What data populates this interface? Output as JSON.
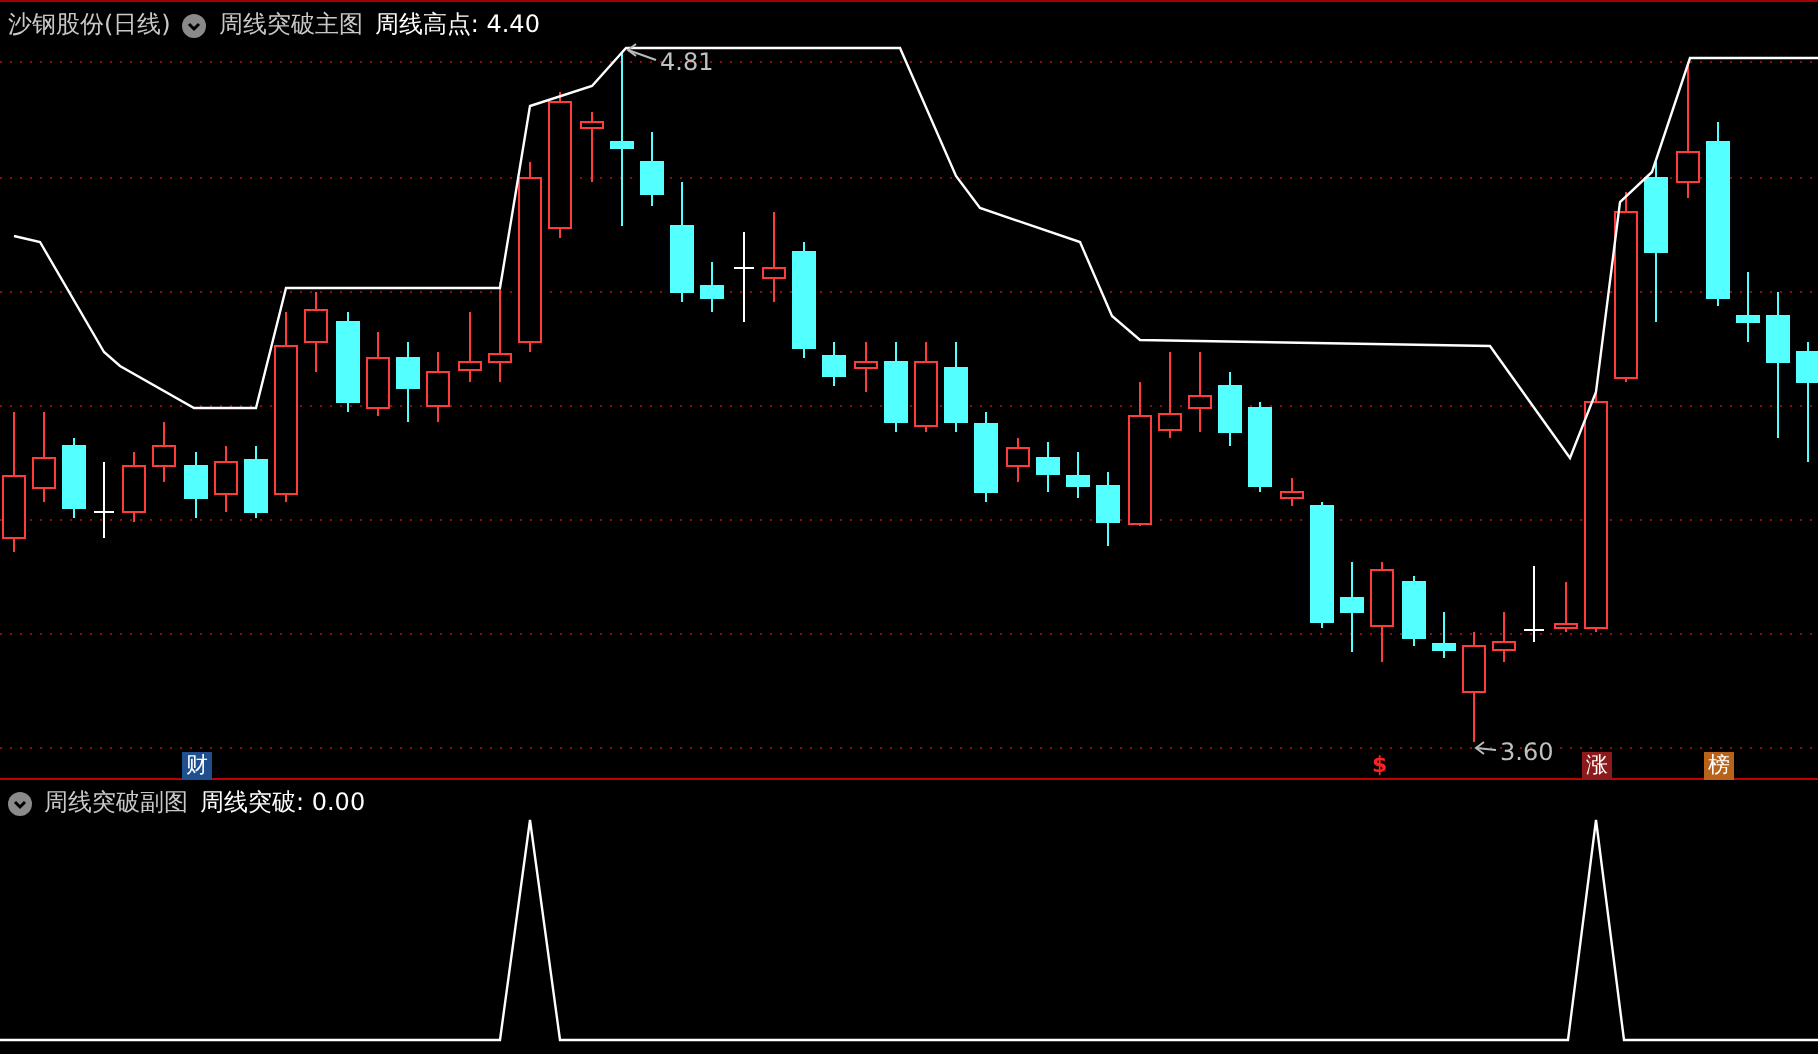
{
  "main_chart": {
    "title": "沙钢股份(日线)",
    "indicator": "周线突破主图",
    "value": "周线高点: 4.40",
    "price_labels": [
      {
        "kind": "high",
        "text": "4.81"
      },
      {
        "kind": "low",
        "text": "3.60"
      }
    ],
    "markers": [
      {
        "kind": "finance",
        "text": "财"
      },
      {
        "kind": "dollar",
        "text": "$"
      },
      {
        "kind": "rise",
        "text": "涨"
      },
      {
        "kind": "rank",
        "text": "榜"
      }
    ]
  },
  "sub_chart": {
    "indicator": "周线突破副图",
    "value": "周线突破: 0.00"
  }
}
